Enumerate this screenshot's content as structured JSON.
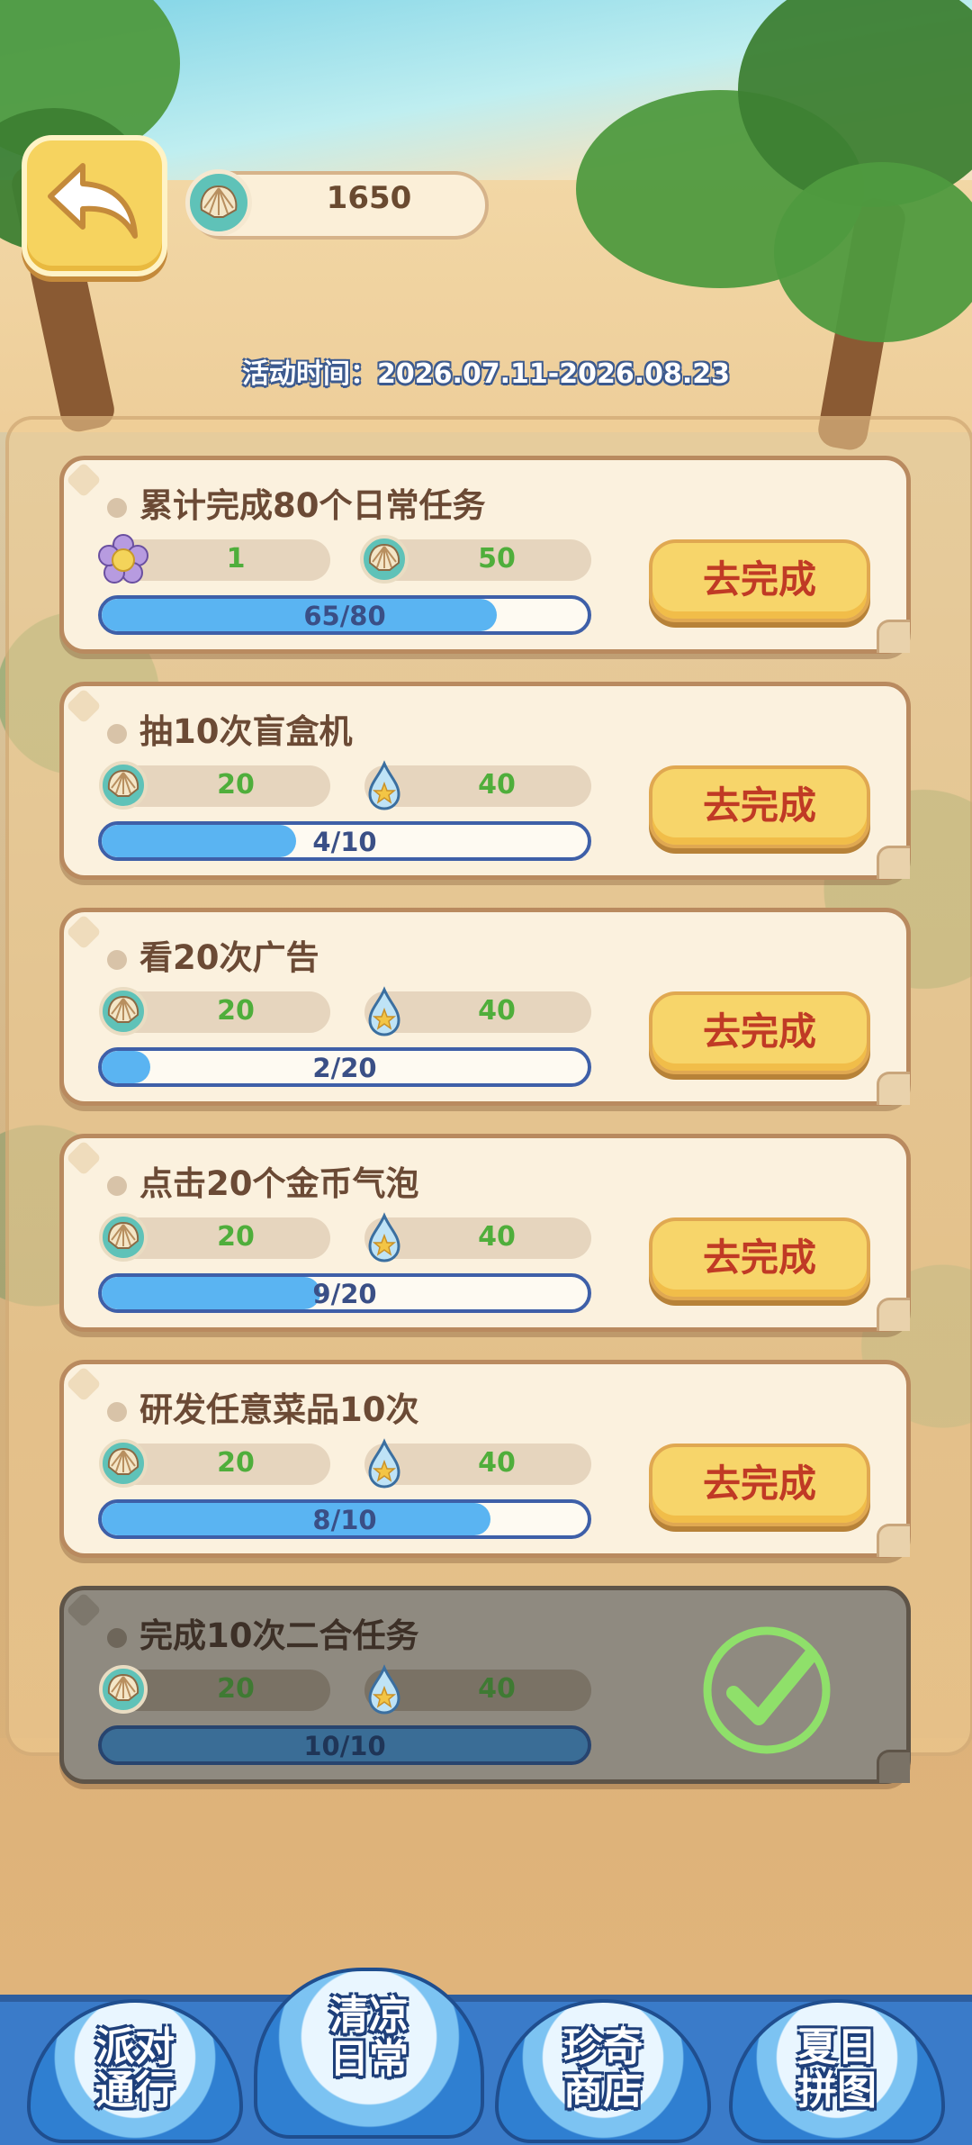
{
  "header": {
    "shell_count": "1650",
    "event_time": "活动时间：2026.07.11-2026.08.23"
  },
  "tasks": [
    {
      "title": "累计完成80个日常任务",
      "rewards": [
        {
          "icon": "flower-token-icon",
          "value": "1"
        },
        {
          "icon": "seashell-icon",
          "value": "50"
        }
      ],
      "progress_text": "65/80",
      "progress": 0.8125,
      "action_label": "去完成",
      "completed": false
    },
    {
      "title": "抽10次盲盒机",
      "rewards": [
        {
          "icon": "seashell-icon",
          "value": "20"
        },
        {
          "icon": "water-drop-star-icon",
          "value": "40"
        }
      ],
      "progress_text": "4/10",
      "progress": 0.4,
      "action_label": "去完成",
      "completed": false
    },
    {
      "title": "看20次广告",
      "rewards": [
        {
          "icon": "seashell-icon",
          "value": "20"
        },
        {
          "icon": "water-drop-star-icon",
          "value": "40"
        }
      ],
      "progress_text": "2/20",
      "progress": 0.1,
      "action_label": "去完成",
      "completed": false
    },
    {
      "title": "点击20个金币气泡",
      "rewards": [
        {
          "icon": "seashell-icon",
          "value": "20"
        },
        {
          "icon": "water-drop-star-icon",
          "value": "40"
        }
      ],
      "progress_text": "9/20",
      "progress": 0.45,
      "action_label": "去完成",
      "completed": false
    },
    {
      "title": "研发任意菜品10次",
      "rewards": [
        {
          "icon": "seashell-icon",
          "value": "20"
        },
        {
          "icon": "water-drop-star-icon",
          "value": "40"
        }
      ],
      "progress_text": "8/10",
      "progress": 0.8,
      "action_label": "去完成",
      "completed": false
    },
    {
      "title": "完成10次二合任务",
      "rewards": [
        {
          "icon": "seashell-icon",
          "value": "20"
        },
        {
          "icon": "water-drop-star-icon",
          "value": "40"
        }
      ],
      "progress_text": "10/10",
      "progress": 1.0,
      "action_label": "",
      "completed": true
    }
  ],
  "nav": [
    {
      "label": "派对\n通行",
      "active": false
    },
    {
      "label": "清凉\n日常",
      "active": true
    },
    {
      "label": "珍奇\n商店",
      "active": false
    },
    {
      "label": "夏日\n拼图",
      "active": false
    }
  ],
  "colors": {
    "button_yellow": "#f7d56a",
    "button_text_red": "#c03a25",
    "progress_blue": "#5ab4f2",
    "reward_green": "#4fae3b",
    "nav_blue": "#3a7bc9"
  }
}
